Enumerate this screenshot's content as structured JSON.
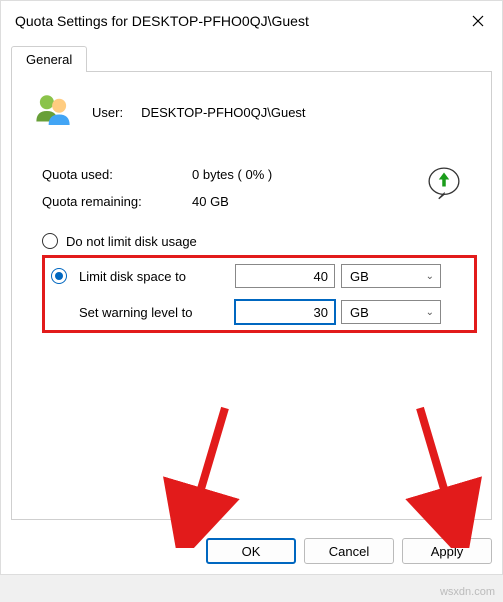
{
  "window": {
    "title": "Quota Settings for DESKTOP-PFHO0QJ\\Guest"
  },
  "tabs": {
    "general": "General"
  },
  "user": {
    "label": "User:",
    "value": "DESKTOP-PFHO0QJ\\Guest"
  },
  "quota": {
    "used_label": "Quota used:",
    "used_value": "0 bytes ( 0% )",
    "remaining_label": "Quota remaining:",
    "remaining_value": "40 GB"
  },
  "options": {
    "no_limit": "Do not limit disk usage",
    "limit": "Limit disk space to",
    "warning": "Set warning level to",
    "limit_value": "40",
    "limit_unit": "GB",
    "warning_value": "30",
    "warning_unit": "GB"
  },
  "buttons": {
    "ok": "OK",
    "cancel": "Cancel",
    "apply": "Apply"
  },
  "watermark": "wsxdn.com"
}
